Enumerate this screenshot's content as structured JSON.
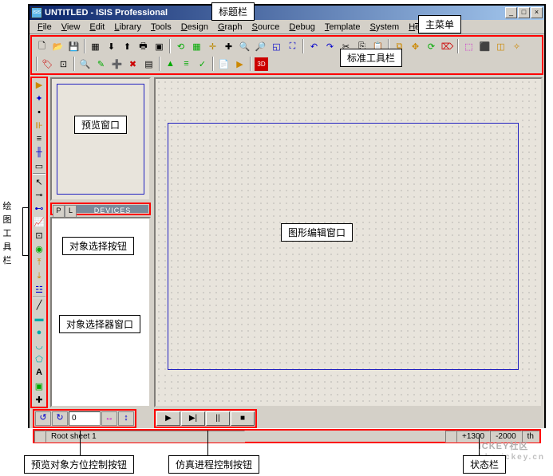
{
  "title": "UNTITLED - ISIS Professional",
  "menus": [
    "File",
    "View",
    "Edit",
    "Library",
    "Tools",
    "Design",
    "Graph",
    "Source",
    "Debug",
    "Template",
    "System",
    "Help"
  ],
  "picker": {
    "p": "P",
    "l": "L",
    "label": "DEVICES"
  },
  "orientation": {
    "value": "0"
  },
  "status": {
    "sheet": "Root sheet 1",
    "coord1": "+1300",
    "coord2": "-2000",
    "unit": "th"
  },
  "callouts": {
    "titlebar": "标题栏",
    "mainmenu": "主菜单",
    "stdtoolbar": "标准工具栏",
    "drawtoolbar": "绘图工具栏",
    "preview": "预览窗口",
    "objselbtn": "对象选择按钮",
    "objselwin": "对象选择器窗口",
    "editor": "图形编辑窗口",
    "orient": "预览对象方位控制按钮",
    "sim": "仿真进程控制按钮",
    "statusbar": "状态栏"
  },
  "watermark": {
    "main": "ICKEY社区",
    "sub": "bbs.ickey.cn"
  }
}
